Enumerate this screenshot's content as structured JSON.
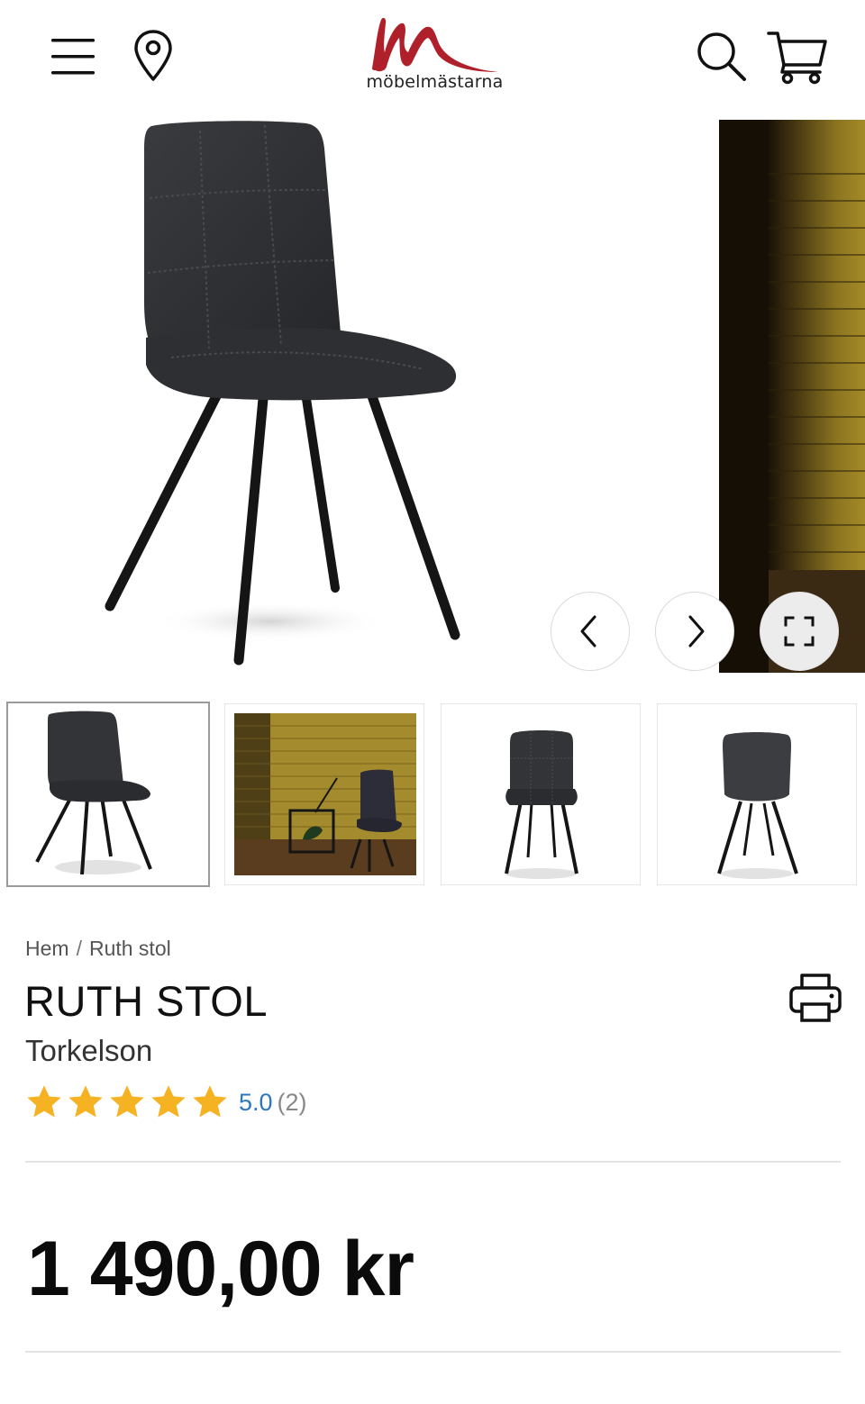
{
  "header": {
    "brand_name": "möbelmästarna",
    "brand_color": "#b0202a",
    "icons": [
      "menu-icon",
      "location-pin-icon",
      "search-icon",
      "cart-icon"
    ]
  },
  "gallery": {
    "slides": [
      "chair-front-three-quarter",
      "chair-yellow-brick-wall"
    ],
    "controls": {
      "prev_icon": "chevron-left-icon",
      "next_icon": "chevron-right-icon",
      "fullscreen_icon": "fullscreen-icon"
    },
    "thumbnails": [
      {
        "label": "chair-three-quarter-view",
        "active": true
      },
      {
        "label": "chair-yellow-brick-wall",
        "active": false
      },
      {
        "label": "chair-front-view",
        "active": false
      },
      {
        "label": "chair-back-view",
        "active": false
      }
    ]
  },
  "product": {
    "breadcrumb": {
      "home": "Hem",
      "separator": "/",
      "current": "Ruth stol"
    },
    "title": "RUTH STOL",
    "brand": "Torkelson",
    "rating": {
      "value": "5.0",
      "count": "(2)",
      "stars": 5,
      "max_stars": 5,
      "star_color": "#f5b324"
    },
    "price": "1 490,00 kr",
    "print_icon": "printer-icon"
  }
}
